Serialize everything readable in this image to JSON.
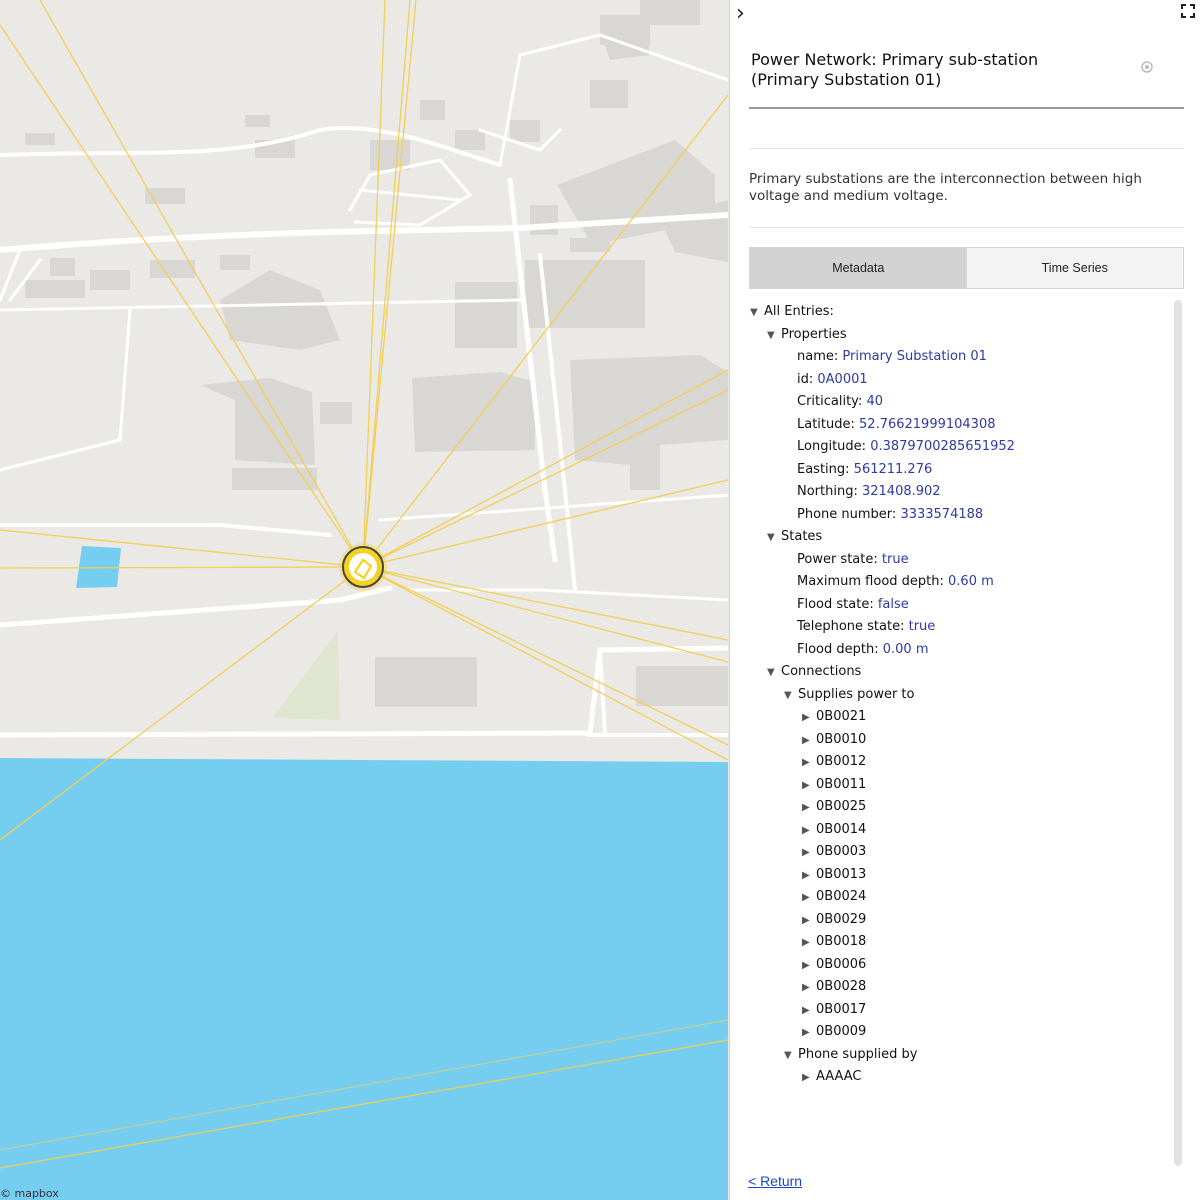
{
  "map": {
    "attribution": "© mapbox"
  },
  "panel": {
    "title": "Power Network: Primary sub-station (Primary Substation 01)",
    "description": "Primary substations are the interconnection between high voltage and medium voltage.",
    "tabs": [
      {
        "label": "Metadata",
        "active": true
      },
      {
        "label": "Time Series",
        "active": false
      }
    ],
    "return_label": "< Return",
    "icons": {
      "collapse": "chevron-right-icon",
      "expand": "fullscreen-icon",
      "locate": "target-icon"
    }
  },
  "tree": {
    "root": "All Entries:",
    "properties_label": "Properties",
    "properties": [
      {
        "key": "name",
        "value": "Primary Substation 01"
      },
      {
        "key": "id",
        "value": "0A0001"
      },
      {
        "key": "Criticality",
        "value": "40"
      },
      {
        "key": "Latitude",
        "value": "52.76621999104308"
      },
      {
        "key": "Longitude",
        "value": "0.3879700285651952"
      },
      {
        "key": "Easting",
        "value": "561211.276"
      },
      {
        "key": "Northing",
        "value": "321408.902"
      },
      {
        "key": "Phone number",
        "value": "3333574188"
      }
    ],
    "states_label": "States",
    "states": [
      {
        "key": "Power state",
        "value": "true"
      },
      {
        "key": "Maximum flood depth",
        "value": "0.60 m"
      },
      {
        "key": "Flood state",
        "value": "false"
      },
      {
        "key": "Telephone state",
        "value": "true"
      },
      {
        "key": "Flood depth",
        "value": "0.00 m"
      }
    ],
    "connections_label": "Connections",
    "supplies_label": "Supplies power to",
    "supplies": [
      "0B0021",
      "0B0010",
      "0B0012",
      "0B0011",
      "0B0025",
      "0B0014",
      "0B0003",
      "0B0013",
      "0B0024",
      "0B0029",
      "0B0018",
      "0B0006",
      "0B0028",
      "0B0017",
      "0B0009"
    ],
    "phone_supplied_label": "Phone supplied by",
    "phone_supplied": [
      "AAAAC"
    ]
  },
  "colors": {
    "map_land": "#ebe9e6",
    "water": "#75cdef",
    "building": "#d9d7d3",
    "road": "#ffffff",
    "power_line": "#f2cf55",
    "substation_marker": "#f5d21f",
    "value_text": "#2d3aa6",
    "active_tab": "#d3d3d3"
  }
}
